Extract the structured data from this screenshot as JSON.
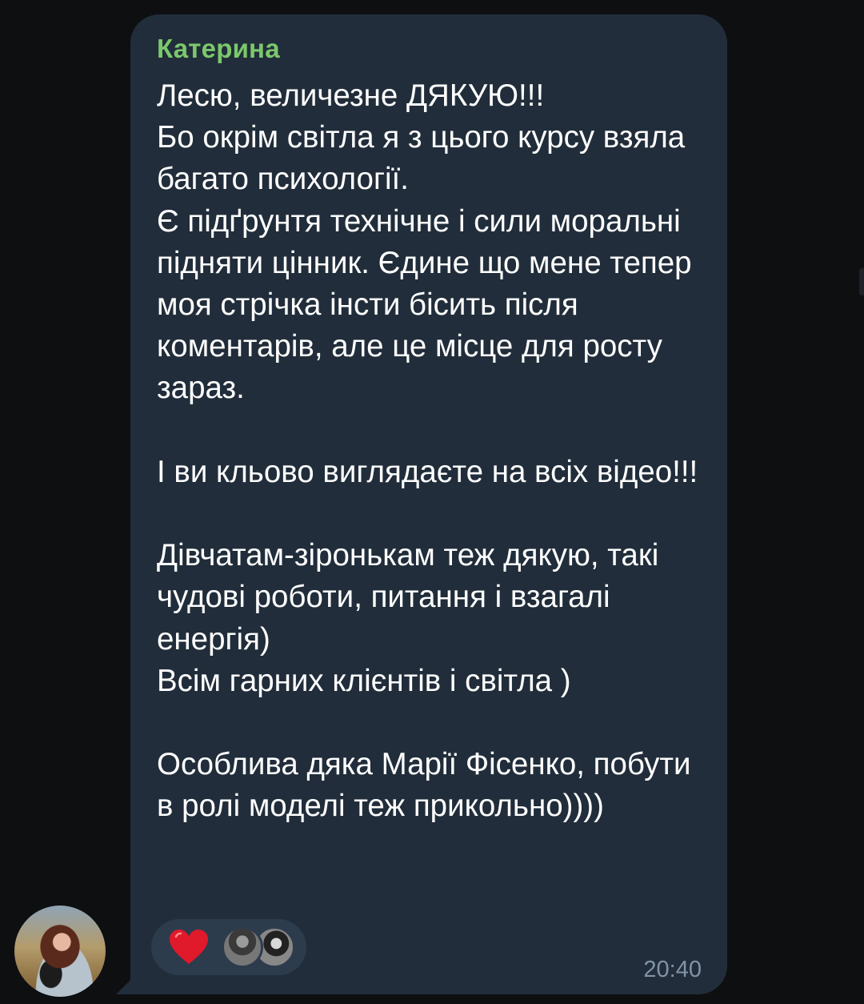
{
  "message": {
    "sender": "Катерина",
    "text": "Лесю, величезне ДЯКУЮ!!!\nБо окрім світла я з цього курсу взяла багато психології.\nЄ підґрунтя технічне і сили моральні підняти цінник. Єдине що мене тепер моя стрічка інсти бісить після коментарів, але це місце для росту зараз.\n\nІ ви кльово виглядаєте на всіх відео!!!\n\nДівчатам-зіронькам теж дякую, такі чудові роботи, питання і взагалі енергія)\nВсім гарних клієнтів і світла )\n\nОсоблива дяка Марії Фісенко, побути в ролі моделі теж прикольно))))",
    "time": "20:40"
  },
  "reaction": {
    "emoji_icon": "heart-icon",
    "color": "#e0192b"
  },
  "colors": {
    "background": "#0e0f11",
    "bubble": "#212d3a",
    "sender_name": "#7bc86c",
    "reaction_pill": "#2d3c4d",
    "timestamp": "#8193a6"
  }
}
